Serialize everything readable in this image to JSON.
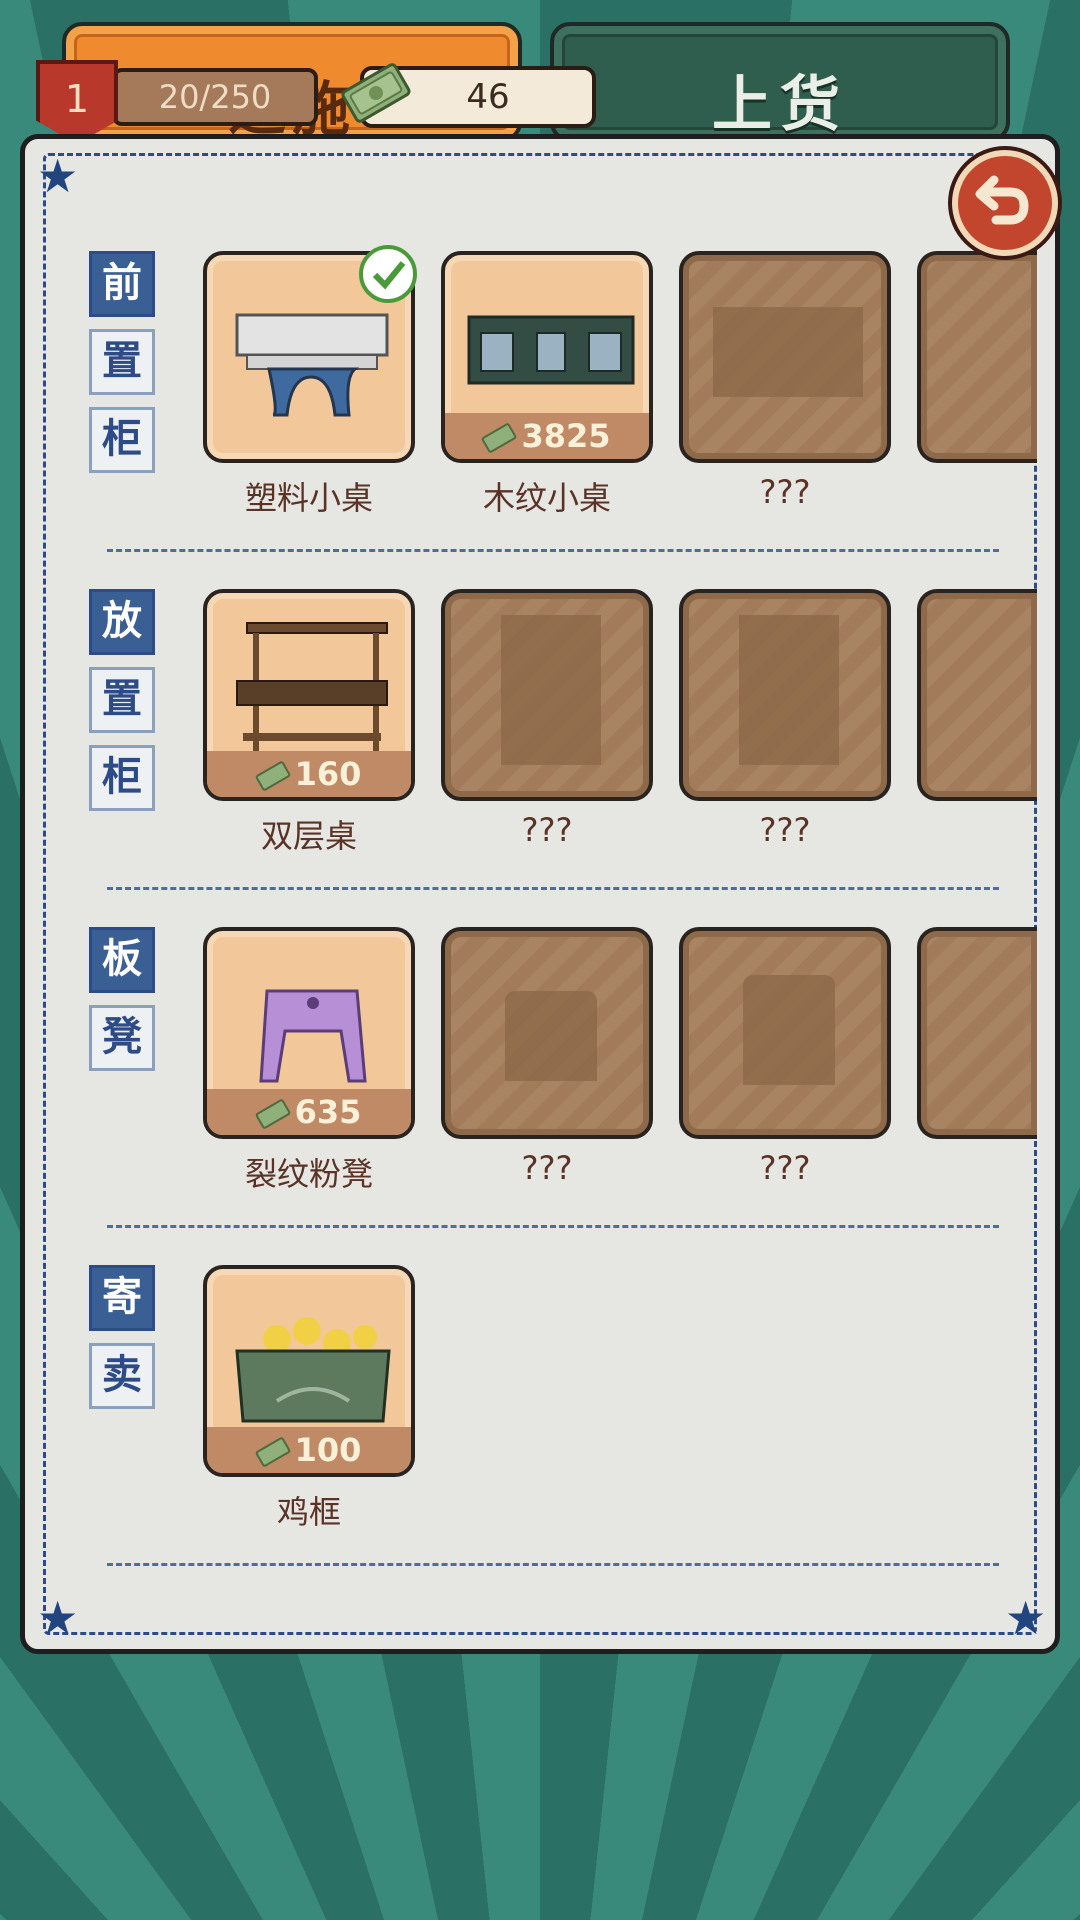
{
  "tabs": {
    "left_label": "道施",
    "right_label": "上货"
  },
  "status": {
    "level": "1",
    "exp": "20/250",
    "money": "46"
  },
  "categories": [
    {
      "label_chars": [
        "前",
        "置",
        "柜"
      ],
      "items": [
        {
          "name": "塑料小桌",
          "price": "",
          "state": "owned",
          "selected": true
        },
        {
          "name": "木纹小桌",
          "price": "3825",
          "state": "owned",
          "selected": false
        },
        {
          "name": "???",
          "price": "",
          "state": "locked",
          "selected": false
        }
      ]
    },
    {
      "label_chars": [
        "放",
        "置",
        "柜"
      ],
      "items": [
        {
          "name": "双层桌",
          "price": "160",
          "state": "owned",
          "selected": false
        },
        {
          "name": "???",
          "price": "",
          "state": "locked",
          "selected": false
        },
        {
          "name": "???",
          "price": "",
          "state": "locked",
          "selected": false
        }
      ]
    },
    {
      "label_chars": [
        "板",
        "凳"
      ],
      "items": [
        {
          "name": "裂纹粉凳",
          "price": "635",
          "state": "owned",
          "selected": false
        },
        {
          "name": "???",
          "price": "",
          "state": "locked",
          "selected": false
        },
        {
          "name": "???",
          "price": "",
          "state": "locked",
          "selected": false
        }
      ]
    },
    {
      "label_chars": [
        "寄",
        "卖"
      ],
      "items": [
        {
          "name": "鸡框",
          "price": "100",
          "state": "owned",
          "selected": false
        }
      ]
    }
  ],
  "colors": {
    "accent_orange": "#f08a2e",
    "tab_green": "#2f5e4f",
    "ink_blue": "#2d4b86",
    "card_owned": "#f2c79a",
    "card_locked": "#a27c5a",
    "back_button": "#c2452e"
  },
  "icons": {
    "back": "back-arrow-icon",
    "money": "money-bill-icon",
    "selected": "checkmark-icon",
    "level": "level-shield-icon"
  }
}
